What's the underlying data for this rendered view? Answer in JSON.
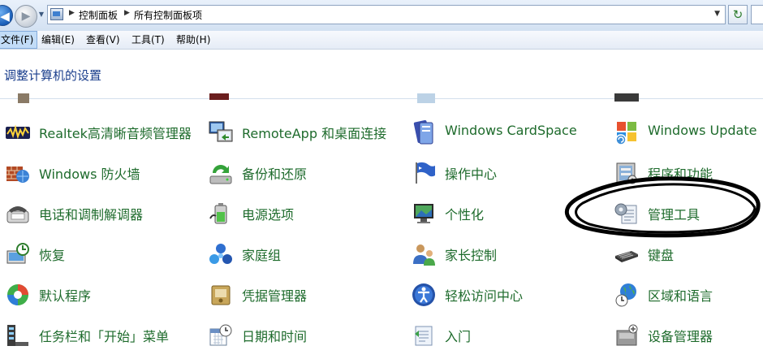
{
  "address_bar": {
    "breadcrumbs": [
      "控制面板",
      "所有控制面板项"
    ]
  },
  "menu": {
    "items": [
      "文件(F)",
      "编辑(E)",
      "查看(V)",
      "工具(T)",
      "帮助(H)"
    ]
  },
  "header": {
    "title": "调整计算机的设置"
  },
  "items": [
    [
      "Realtek高清晰音频管理器",
      "RemoteApp 和桌面连接",
      "Windows CardSpace",
      "Windows Update"
    ],
    [
      "Windows 防火墙",
      "备份和还原",
      "操作中心",
      "程序和功能"
    ],
    [
      "电话和调制解调器",
      "电源选项",
      "个性化",
      "管理工具"
    ],
    [
      "恢复",
      "家庭组",
      "家长控制",
      "键盘"
    ],
    [
      "默认程序",
      "凭据管理器",
      "轻松访问中心",
      "区域和语言"
    ],
    [
      "任务栏和「开始」菜单",
      "日期和时间",
      "入门",
      "设备管理器"
    ]
  ],
  "icons": [
    [
      "audio-manager-icon",
      "remote-desktop-icon",
      "cardspace-icon",
      "windows-update-icon"
    ],
    [
      "firewall-icon",
      "backup-icon",
      "action-center-icon",
      "programs-icon"
    ],
    [
      "phone-modem-icon",
      "power-options-icon",
      "personalization-icon",
      "admin-tools-icon"
    ],
    [
      "recovery-icon",
      "homegroup-icon",
      "parental-controls-icon",
      "keyboard-icon"
    ],
    [
      "default-programs-icon",
      "credential-manager-icon",
      "ease-of-access-icon",
      "region-language-icon"
    ],
    [
      "taskbar-icon",
      "date-time-icon",
      "getting-started-icon",
      "device-manager-icon"
    ]
  ],
  "colors": {
    "item_label": "#1e6b2c",
    "header_title": "#1a3e8c",
    "annotation_ink": "#000000"
  }
}
